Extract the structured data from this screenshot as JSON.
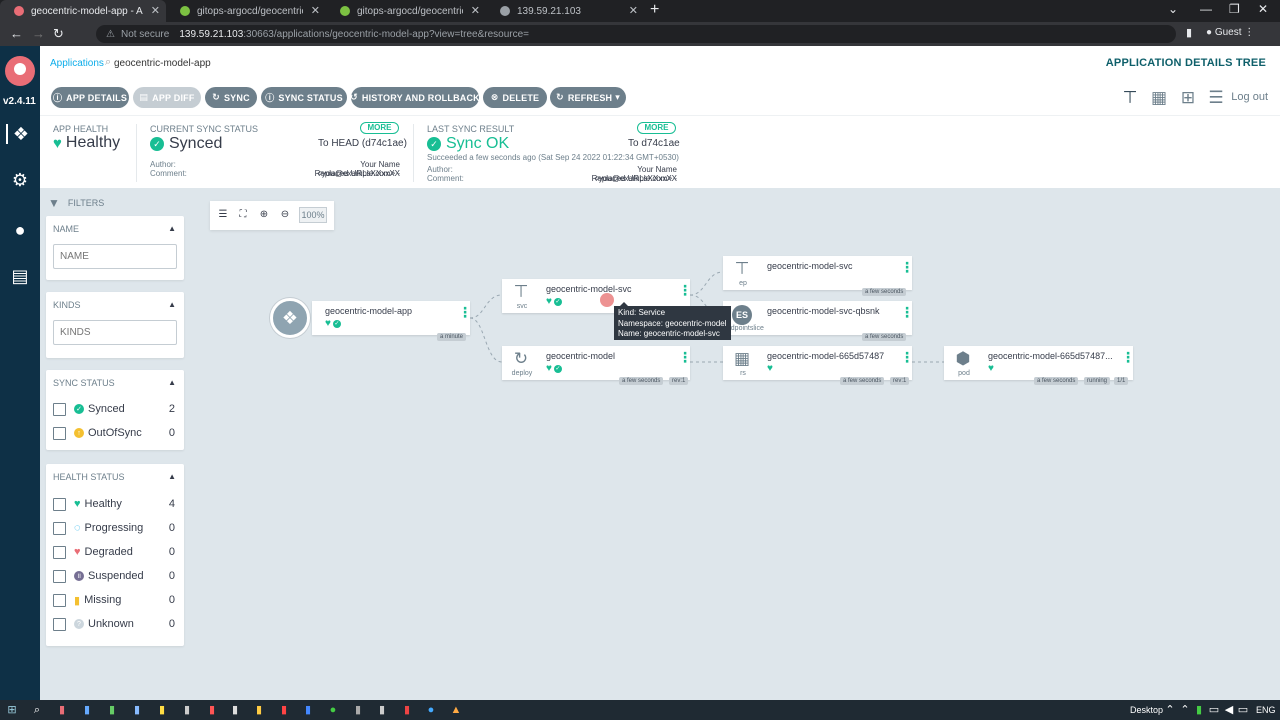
{
  "browser": {
    "tabs": [
      {
        "title": "geocentric-model-app - Applicat",
        "active": true,
        "color": "#e96d76"
      },
      {
        "title": "gitops-argocd/geocentric-app.y",
        "active": false,
        "color": "#7cc142"
      },
      {
        "title": "gitops-argocd/geocentric-mode",
        "active": false,
        "color": "#7cc142"
      },
      {
        "title": "139.59.21.103",
        "active": false,
        "color": "#9aa0a6"
      }
    ],
    "not_secure": "Not secure",
    "url_host": "139.59.21.103",
    "url_rest": ":30663/applications/geocentric-model-app?view=tree&resource=",
    "profile": "Guest"
  },
  "nav": {
    "version": "v2.4.11"
  },
  "breadcrumb": {
    "applications": "Applications",
    "current": "geocentric-model-app",
    "title": "APPLICATION DETAILS TREE"
  },
  "toolbar": {
    "app_details": "APP DETAILS",
    "app_diff": "APP DIFF",
    "sync": "SYNC",
    "sync_status": "SYNC STATUS",
    "history": "HISTORY AND ROLLBACK",
    "delete": "DELETE",
    "refresh": "REFRESH",
    "logout": "Log out"
  },
  "status": {
    "app_health_label": "APP HEALTH",
    "app_health": "Healthy",
    "current_sync_label": "CURRENT SYNC STATUS",
    "current_sync": "Synced",
    "current_more": "MORE",
    "current_to": "To HEAD (d74c1ae)",
    "author_label": "Author:",
    "comment_label": "Comment:",
    "author": "Your Name <you@example.com> -",
    "comment": "Replaced URLsXXxxXX",
    "last_sync_label": "LAST SYNC RESULT",
    "last_sync": "Sync OK",
    "last_more": "MORE",
    "last_to": "To d74c1ae",
    "succeeded": "Succeeded a few seconds ago (Sat Sep 24 2022 01:22:34 GMT+0530)"
  },
  "filters": {
    "title": "FILTERS",
    "name_label": "NAME",
    "name_placeholder": "NAME",
    "kinds_label": "KINDS",
    "kinds_placeholder": "KINDS",
    "sync_label": "SYNC STATUS",
    "sync_items": [
      {
        "label": "Synced",
        "count": "2",
        "color": "#18be94"
      },
      {
        "label": "OutOfSync",
        "count": "0",
        "color": "#f4c030"
      }
    ],
    "health_label": "HEALTH STATUS",
    "health_items": [
      {
        "label": "Healthy",
        "count": "4",
        "color": "#18be94"
      },
      {
        "label": "Progressing",
        "count": "0",
        "color": "#0dadea"
      },
      {
        "label": "Degraded",
        "count": "0",
        "color": "#e96d76"
      },
      {
        "label": "Suspended",
        "count": "0",
        "color": "#766f94"
      },
      {
        "label": "Missing",
        "count": "0",
        "color": "#f4c030"
      },
      {
        "label": "Unknown",
        "count": "0",
        "color": "#ccd6dd"
      }
    ]
  },
  "graph": {
    "zoom": "100%",
    "nodes": {
      "app": {
        "name": "geocentric-model-app",
        "age": "a minute"
      },
      "svc": {
        "name": "geocentric-model-svc",
        "kind": "svc"
      },
      "deploy": {
        "name": "geocentric-model",
        "kind": "deploy",
        "age": "a few seconds",
        "rev": "rev:1"
      },
      "ep": {
        "name": "geocentric-model-svc",
        "kind": "ep",
        "age": "a few seconds"
      },
      "eps": {
        "name": "geocentric-model-svc-qbsnk",
        "kind": "endpointslice",
        "age": "a few seconds",
        "badge": "ES"
      },
      "rs": {
        "name": "geocentric-model-665d57487",
        "kind": "rs",
        "age": "a few seconds",
        "rev": "rev:1"
      },
      "pod": {
        "name": "geocentric-model-665d57487...",
        "kind": "pod",
        "age": "a few seconds",
        "state": "running",
        "ready": "1/1"
      }
    },
    "tooltip": {
      "kind": "Kind: Service",
      "namespace": "Namespace: geocentric-model",
      "name": "Name: geocentric-model-svc"
    }
  },
  "taskbar": {
    "desktop": "Desktop",
    "lang": "ENG"
  }
}
